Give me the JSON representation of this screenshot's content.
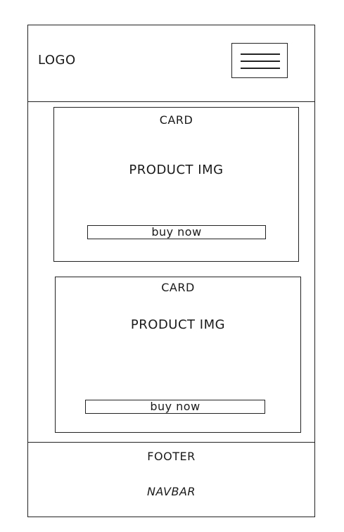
{
  "header": {
    "logo_text": "LOGO",
    "menu_icon": "hamburger-menu-icon"
  },
  "cards": [
    {
      "title": "CARD",
      "image_placeholder": "PRODUCT IMG",
      "button_label": "buy now"
    },
    {
      "title": "CARD",
      "image_placeholder": "PRODUCT IMG",
      "button_label": "buy now"
    }
  ],
  "footer": {
    "label": "FOOTER",
    "navbar_label": "NAVBAR"
  },
  "colors": {
    "stroke": "#222222",
    "background": "#ffffff"
  }
}
